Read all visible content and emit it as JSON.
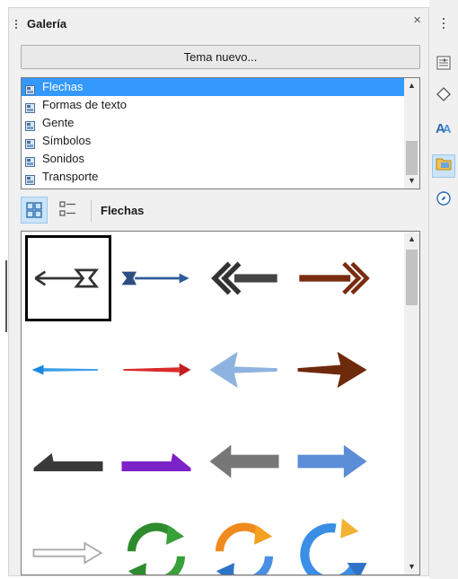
{
  "panel": {
    "title": "Galería",
    "new_theme_button": "Tema nuevo...",
    "themes": [
      {
        "label": "Flechas",
        "selected": true
      },
      {
        "label": "Formas de texto",
        "selected": false
      },
      {
        "label": "Gente",
        "selected": false
      },
      {
        "label": "Símbolos",
        "selected": false
      },
      {
        "label": "Sonidos",
        "selected": false
      },
      {
        "label": "Transporte",
        "selected": false
      }
    ],
    "current_theme_label": "Flechas",
    "view_modes": [
      {
        "icon": "icon-view-icon",
        "active": true
      },
      {
        "icon": "detail-view-icon",
        "active": false
      }
    ],
    "gallery_items": [
      {
        "icon": "arrow-left-outline-icon",
        "selected": true
      },
      {
        "icon": "arrow-right-blue-icon",
        "selected": false
      },
      {
        "icon": "double-chevron-left-icon",
        "selected": false
      },
      {
        "icon": "double-chevron-right-brown-icon",
        "selected": false
      },
      {
        "icon": "arrow-left-blue-thin-icon",
        "selected": false
      },
      {
        "icon": "arrow-right-red-thin-icon",
        "selected": false
      },
      {
        "icon": "arrow-left-lightblue-icon",
        "selected": false
      },
      {
        "icon": "arrow-right-brown-icon",
        "selected": false
      },
      {
        "icon": "arrow-corner-left-gray-icon",
        "selected": false
      },
      {
        "icon": "arrow-corner-right-purple-icon",
        "selected": false
      },
      {
        "icon": "arrow-left-gray-block-icon",
        "selected": false
      },
      {
        "icon": "arrow-right-blue-block-icon",
        "selected": false
      },
      {
        "icon": "arrow-right-outline-gray-icon",
        "selected": false
      },
      {
        "icon": "circular-arrows-green-icon",
        "selected": false
      },
      {
        "icon": "circular-arrows-orange-blue-icon",
        "selected": false
      },
      {
        "icon": "circular-arrow-blue-icon",
        "selected": false
      }
    ]
  },
  "sidebar_tabs": [
    {
      "icon": "properties-icon",
      "active": false
    },
    {
      "icon": "styles-shape-icon",
      "active": false
    },
    {
      "icon": "fontwork-icon",
      "active": false
    },
    {
      "icon": "gallery-icon",
      "active": true
    },
    {
      "icon": "navigator-icon",
      "active": false
    }
  ],
  "colors": {
    "selection": "#3399ff",
    "active_button": "#cce4f7",
    "panel_background": "#f0f0f0"
  }
}
